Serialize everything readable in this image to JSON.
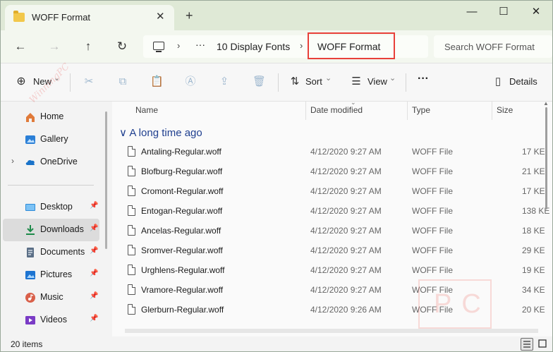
{
  "window": {
    "tab_title": "WOFF Format",
    "tab_close": "✕",
    "new_tab": "+",
    "minimize": "—",
    "maximize": "☐",
    "close": "✕"
  },
  "nav": {
    "back": "←",
    "forward": "→",
    "up": "↑",
    "refresh": "↻"
  },
  "address": {
    "chevron": "›",
    "overflow": "···",
    "crumbs": [
      "10 Display Fonts",
      "WOFF Format"
    ]
  },
  "search": {
    "placeholder": "Search WOFF Format"
  },
  "toolbar": {
    "new_label": "New",
    "sort_label": "Sort",
    "view_label": "View",
    "more_label": "···",
    "details_label": "Details",
    "caret": "⌄"
  },
  "sidebar": {
    "items": [
      {
        "label": "Home",
        "icon": "home-icon"
      },
      {
        "label": "Gallery",
        "icon": "gallery-icon"
      },
      {
        "label": "OneDrive",
        "icon": "cloud-icon",
        "expander": "›"
      },
      {
        "label": "Desktop",
        "icon": "desktop-icon",
        "pinned": true
      },
      {
        "label": "Downloads",
        "icon": "download-icon",
        "pinned": true,
        "selected": true
      },
      {
        "label": "Documents",
        "icon": "documents-icon",
        "pinned": true
      },
      {
        "label": "Pictures",
        "icon": "pictures-icon",
        "pinned": true
      },
      {
        "label": "Music",
        "icon": "music-icon",
        "pinned": true
      },
      {
        "label": "Videos",
        "icon": "videos-icon",
        "pinned": true
      }
    ],
    "pin_glyph": "📌"
  },
  "columns": {
    "name": "Name",
    "date": "Date modified",
    "type": "Type",
    "size": "Size"
  },
  "group": {
    "title": "A long time ago",
    "chevron": "∨"
  },
  "files": [
    {
      "name": "Antaling-Regular.woff",
      "date": "4/12/2020 9:27 AM",
      "type": "WOFF File",
      "size": "17 KE"
    },
    {
      "name": "Blofburg-Regular.woff",
      "date": "4/12/2020 9:27 AM",
      "type": "WOFF File",
      "size": "21 KE"
    },
    {
      "name": "Cromont-Regular.woff",
      "date": "4/12/2020 9:27 AM",
      "type": "WOFF File",
      "size": "17 KE"
    },
    {
      "name": "Entogan-Regular.woff",
      "date": "4/12/2020 9:27 AM",
      "type": "WOFF File",
      "size": "138 KE"
    },
    {
      "name": "Ancelas-Regular.woff",
      "date": "4/12/2020 9:27 AM",
      "type": "WOFF File",
      "size": "18 KE"
    },
    {
      "name": "Sromver-Regular.woff",
      "date": "4/12/2020 9:27 AM",
      "type": "WOFF File",
      "size": "29 KE"
    },
    {
      "name": "Urghlens-Regular.woff",
      "date": "4/12/2020 9:27 AM",
      "type": "WOFF File",
      "size": "19 KE"
    },
    {
      "name": "Vramore-Regular.woff",
      "date": "4/12/2020 9:27 AM",
      "type": "WOFF File",
      "size": "34 KE"
    },
    {
      "name": "Glerburn-Regular.woff",
      "date": "4/12/2020 9:26 AM",
      "type": "WOFF File",
      "size": "20 KE"
    }
  ],
  "status": {
    "count": "20 items"
  },
  "watermark": {
    "letters": "PC",
    "diagonal": "WinningPC"
  },
  "colors": {
    "highlight_border": "#e8403a",
    "titlebar": "#dfe9d6",
    "group_title": "#1f3f8f"
  }
}
